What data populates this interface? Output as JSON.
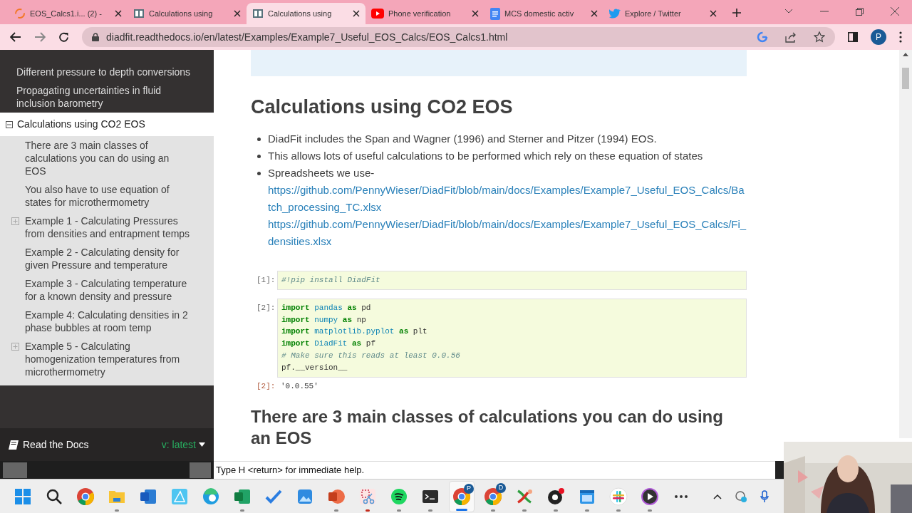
{
  "tabs": [
    {
      "title": "EOS_Calcs1.i... (2) -",
      "selected": false
    },
    {
      "title": "Calculations using",
      "selected": false
    },
    {
      "title": "Calculations using",
      "selected": true
    },
    {
      "title": "Phone verification",
      "selected": false
    },
    {
      "title": "MCS domestic activ",
      "selected": false
    },
    {
      "title": "Explore / Twitter",
      "selected": false
    }
  ],
  "address_bar": {
    "url": "diadfit.readthedocs.io/en/latest/Examples/Example7_Useful_EOS_Calcs/EOS_Calcs1.html",
    "profile": "P"
  },
  "sidebar": {
    "items": [
      {
        "label": "Different pressure to depth conversions",
        "kind": "link"
      },
      {
        "label": "Propagating uncertainties in fluid inclusion barometry",
        "kind": "link"
      },
      {
        "label": "Calculations using CO2 EOS",
        "kind": "current",
        "expanded": true,
        "children": [
          {
            "label": "There are 3 main classes of calculations you can do using an EOS",
            "kind": "leaf"
          },
          {
            "label": "You also have to use equation of states for microthermometry",
            "kind": "leaf"
          },
          {
            "label": "Example 1 - Calculating Pressures from densities and entrapment temps",
            "kind": "collapsed"
          },
          {
            "label": "Example 2 - Calculating density for given Pressure and temperature",
            "kind": "leaf"
          },
          {
            "label": "Example 3 - Calculating temperature for a known density and pressure",
            "kind": "leaf"
          },
          {
            "label": "Example 4: Calculating densities in 2 phase bubbles at room temp",
            "kind": "leaf"
          },
          {
            "label": "Example 5 - Calculating homogenization temperatures from microthermometry",
            "kind": "collapsed"
          }
        ]
      }
    ],
    "footer": {
      "label": "Read the Docs",
      "version": "v: latest"
    }
  },
  "main": {
    "heading": "Calculations using CO2 EOS",
    "bullets": [
      {
        "text": "DiadFit includes the Span and Wagner (1996) and Sterner and Pitzer (1994) EOS."
      },
      {
        "text": "This allows lots of useful calculations to be performed which rely on these equation of states"
      },
      {
        "text": "Spreadsheets we use-",
        "links": [
          "https://github.com/PennyWieser/DiadFit/blob/main/docs/Examples/Example7_Useful_EOS_Calcs/Batch_processing_TC.xlsx",
          "https://github.com/PennyWieser/DiadFit/blob/main/docs/Examples/Example7_Useful_EOS_Calcs/Fi_densities.xlsx"
        ]
      }
    ],
    "cells": [
      {
        "prompt": "[1]:",
        "lines": [
          [
            {
              "text": "#!pip install DiadFit",
              "kind": "comment"
            }
          ]
        ]
      },
      {
        "prompt": "[2]:",
        "lines": [
          [
            {
              "text": "import",
              "kind": "keyword"
            },
            {
              "text": " pandas",
              "kind": "name"
            },
            {
              "text": " as",
              "kind": "keyword"
            },
            {
              "text": " pd",
              "kind": "plain"
            }
          ],
          [
            {
              "text": "import",
              "kind": "keyword"
            },
            {
              "text": " numpy",
              "kind": "name"
            },
            {
              "text": " as",
              "kind": "keyword"
            },
            {
              "text": " np",
              "kind": "plain"
            }
          ],
          [
            {
              "text": "import",
              "kind": "keyword"
            },
            {
              "text": " matplotlib.pyplot",
              "kind": "name"
            },
            {
              "text": " as",
              "kind": "keyword"
            },
            {
              "text": " plt",
              "kind": "plain"
            }
          ],
          [
            {
              "text": "import",
              "kind": "keyword"
            },
            {
              "text": " DiadFit",
              "kind": "name"
            },
            {
              "text": " as",
              "kind": "keyword"
            },
            {
              "text": " pf",
              "kind": "plain"
            }
          ],
          [
            {
              "text": "# Make sure this reads at least 0.0.56",
              "kind": "comment"
            }
          ],
          [
            {
              "text": "pf.__version__",
              "kind": "plain"
            }
          ]
        ],
        "output_prompt": "[2]:",
        "output": "'0.0.55'"
      }
    ],
    "heading2": "There are 3 main classes of calculations you can do using an EOS"
  },
  "terminal_hint": "Type H <return> for immediate help.",
  "taskbar": [
    {
      "kind": "windows",
      "running": false,
      "selected": false
    },
    {
      "kind": "search",
      "running": false,
      "selected": false
    },
    {
      "kind": "chrome",
      "running": false,
      "selected": false
    },
    {
      "kind": "folder",
      "running": true,
      "selected": false
    },
    {
      "kind": "word",
      "running": false,
      "selected": false
    },
    {
      "kind": "affinity",
      "running": false,
      "selected": false
    },
    {
      "kind": "edge",
      "running": false,
      "selected": false
    },
    {
      "kind": "excel",
      "running": true,
      "selected": false
    },
    {
      "kind": "todo",
      "running": false,
      "selected": false
    },
    {
      "kind": "photos",
      "running": false,
      "selected": false
    },
    {
      "kind": "powerpoint",
      "running": true,
      "selected": false
    },
    {
      "kind": "snip",
      "running": true,
      "selected": false
    },
    {
      "kind": "spotify",
      "running": true,
      "selected": false
    },
    {
      "kind": "terminal",
      "running": true,
      "selected": false
    },
    {
      "kind": "chrome",
      "running": true,
      "selected": true,
      "badge": "P"
    },
    {
      "kind": "chrome",
      "running": true,
      "selected": false,
      "badge": "D"
    },
    {
      "kind": "xapp",
      "running": true,
      "selected": false
    },
    {
      "kind": "obs",
      "running": true,
      "selected": false
    },
    {
      "kind": "calendar",
      "running": true,
      "selected": false
    },
    {
      "kind": "slack",
      "running": true,
      "selected": false
    },
    {
      "kind": "player",
      "running": true,
      "selected": false
    },
    {
      "kind": "more",
      "running": false,
      "selected": false
    }
  ]
}
